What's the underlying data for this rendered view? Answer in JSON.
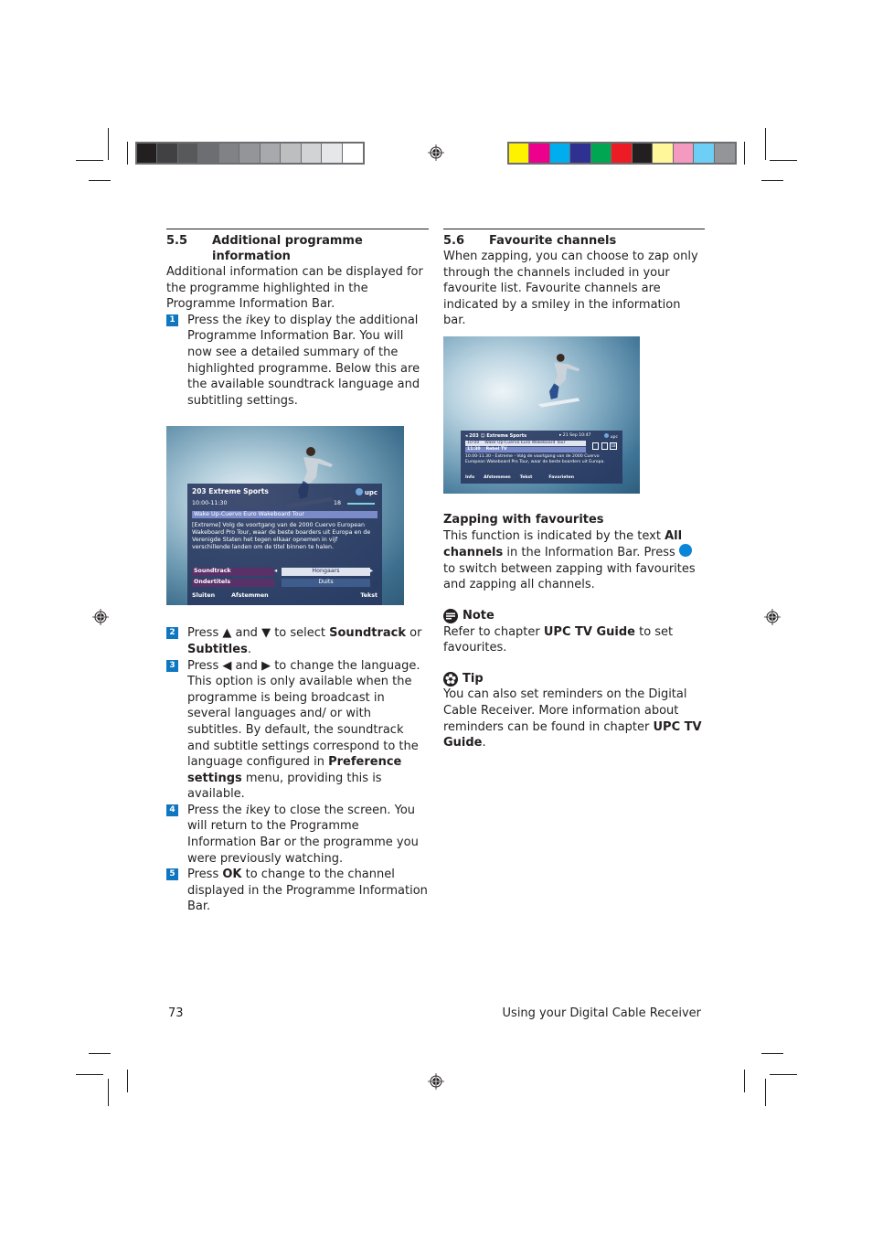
{
  "print_marks": {
    "gray_swatches": [
      "#231f20",
      "#414042",
      "#58595b",
      "#6d6e71",
      "#808285",
      "#939598",
      "#a7a9ac",
      "#bcbec0",
      "#d1d3d4",
      "#e6e7e8",
      "#ffffff"
    ],
    "color_swatches": [
      "#fff200",
      "#ec008c",
      "#00aeef",
      "#2e3192",
      "#00a651",
      "#ed1c24",
      "#231f20",
      "#fff799",
      "#f49ac1",
      "#6dcff6",
      "#939598"
    ]
  },
  "section_5_5": {
    "number": "5.5",
    "title_line1": "Additional programme",
    "title_line2": "information",
    "intro": "Additional information can be displayed for the programme highlighted in the Programme Information Bar.",
    "steps": [
      {
        "num": "1",
        "pre": "Press the ",
        "key": "i",
        "post": "key to display the additional Programme Information Bar. You will now see a detailed summary of the highlighted programme. Below this are the available soundtrack language and subtitling settings."
      },
      {
        "num": "2",
        "pre": "Press ▲ and ▼ to select ",
        "bold1": "Soundtrack",
        "mid": " or ",
        "bold2": "Subtitles",
        "post": "."
      },
      {
        "num": "3",
        "pre": "Press ◀ and ▶ to change the language. This option is only available when the programme is being broadcast in several languages and/ or with subtitles. By default, the soundtrack and subtitle settings correspond to the language configured in ",
        "bold": "Preference settings",
        "post": " menu, providing this is available."
      },
      {
        "num": "4",
        "pre": "Press the ",
        "key": "i",
        "post": "key to close the screen. You will return to the Programme Information Bar or the programme you were previously watching."
      },
      {
        "num": "5",
        "pre": "Press ",
        "bold": "OK",
        "post": " to change to the channel displayed in the Programme Information Bar."
      }
    ],
    "screenshot": {
      "channel": "203  Extreme Sports",
      "brand": "upc",
      "time": "10:00-11:30",
      "rating": "18",
      "programme_title": "Wake Up-Cuervo Euro Wakeboard Tour",
      "description": "[Extreme] Volg de voortgang van de 2000 Cuervo European Wakeboard Pro Tour, waar de beste boarders uit Europa en de Verenigde Staten het tegen elkaar opnemen in vijf verschillende landen om de titel binnen te halen.",
      "soundtrack_label": "Soundtrack",
      "soundtrack_value": "Hongaars",
      "subtitles_label": "Ondertitels",
      "subtitles_value": "Duits",
      "buttons": [
        "Sluiten",
        "Afstemmen",
        "Tekst"
      ]
    }
  },
  "section_5_6": {
    "number": "5.6",
    "title": "Favourite channels",
    "intro": "When zapping, you can choose to zap only through the channels included in your favourite list. Favourite channels are indicated by a smiley in the information bar.",
    "screenshot": {
      "channel": "203 ☺ Extreme Sports",
      "datetime": "21 Sep 10:47",
      "brand": "upc",
      "row1_time": "10:00",
      "row1_title": "Wake Up-Cuervo Euro Wakeboard Tour",
      "row2_time": "11:30",
      "row2_title": "Rebel TV",
      "rating": "18",
      "description": "10.00-11.30 - Extreme - Volg de voortgang van de 2000 Cuervo European Wakeboard Pro Tour, waar de beste boarders uit Europa.",
      "buttons": [
        "Info",
        "Afstemmen",
        "Tekst",
        "Favorieten"
      ]
    },
    "zapping_heading": "Zapping with favourites",
    "zapping_text_pre": "This function is indicated by the text ",
    "zapping_bold": "All channels",
    "zapping_text_mid": " in the Information Bar. Press ",
    "zapping_text_post": " to switch between zapping with favourites and zapping all channels.",
    "note_heading": "Note",
    "note_pre": "Refer to chapter ",
    "note_bold": "UPC TV Guide",
    "note_post": " to set favourites.",
    "tip_heading": "Tip",
    "tip_pre": "You can also set reminders on the Digital Cable Receiver. More information about reminders can be found in chapter ",
    "tip_bold": "UPC TV Guide",
    "tip_post": "."
  },
  "footer": {
    "page_number": "73",
    "running_title": "Using your Digital Cable Receiver"
  }
}
